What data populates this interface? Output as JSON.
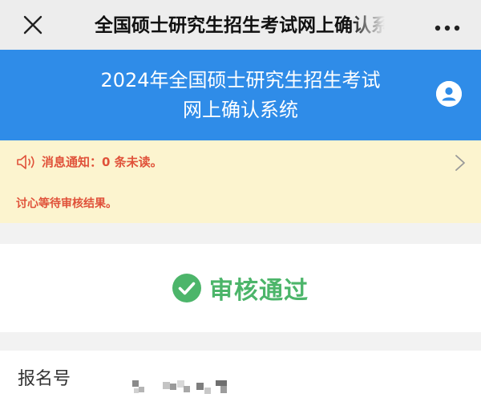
{
  "nav": {
    "title": "全国硕士研究生招生考试网上确认系统"
  },
  "header": {
    "title_line1": "2024年全国硕士研究生招生考试",
    "title_line2": "网上确认系统"
  },
  "notice": {
    "message_label": "消息通知：0 条未读。",
    "marquee": "讨心等待审核结果。"
  },
  "status": {
    "label": "审核通过",
    "color": "#4cb56a"
  },
  "info": {
    "fields": [
      {
        "label": "报名号"
      }
    ]
  },
  "colors": {
    "header_blue": "#2f8ce8",
    "notice_bg": "#fcf4cf",
    "notice_text": "#e0523a"
  },
  "icons": [
    "close-icon",
    "more-icon",
    "user-icon",
    "speaker-icon",
    "chevron-right-icon",
    "check-circle-icon"
  ]
}
